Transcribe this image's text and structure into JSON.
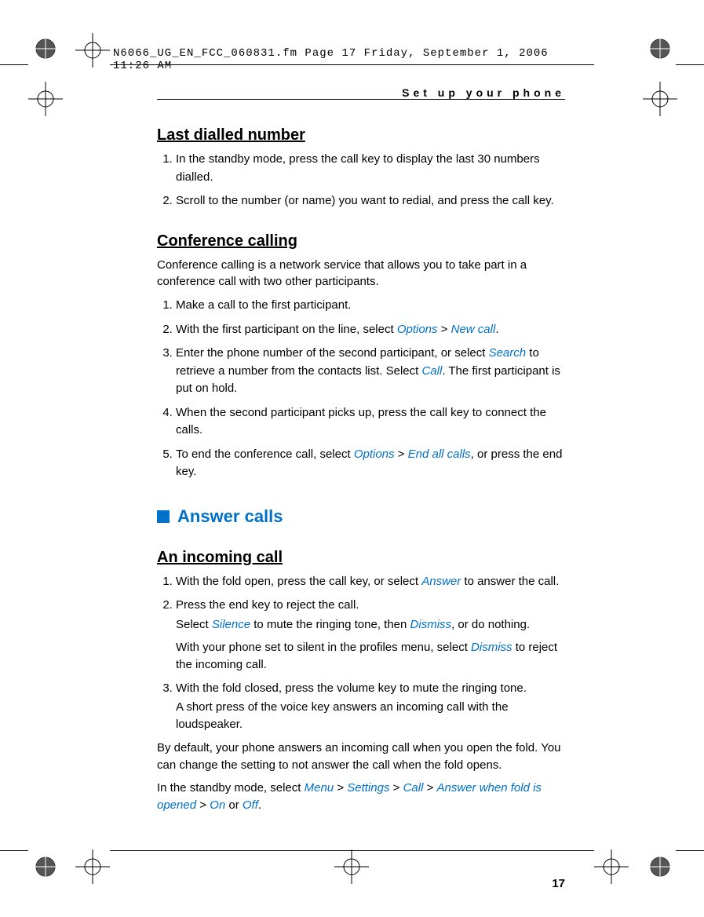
{
  "header_line": "N6066_UG_EN_FCC_060831.fm  Page 17  Friday, September 1, 2006  11:26 AM",
  "running_head": "Set up your phone",
  "page_number": "17",
  "sections": {
    "last_dialled": {
      "title": "Last dialled number",
      "steps": [
        "In the standby mode, press the call key to display the last 30 numbers dialled.",
        "Scroll to the number (or name) you want to redial, and press the call key."
      ]
    },
    "conference": {
      "title": "Conference calling",
      "intro": "Conference calling is a network service that allows you to take part in a conference call with two other participants.",
      "step1": "Make a call to the first participant.",
      "step2_before": "With the first participant on the line, select ",
      "step2_opt": "Options",
      "step2_sep": " > ",
      "step2_newcall": "New call",
      "step2_after": ".",
      "step3_before": "Enter the phone number of the second participant, or select ",
      "step3_search": "Search",
      "step3_mid": " to retrieve a number from the contacts list. Select ",
      "step3_call": "Call",
      "step3_after": ". The first participant is put on hold.",
      "step4": "When the second participant picks up, press the call key to connect the calls.",
      "step5_before": "To end the conference call, select ",
      "step5_opt": "Options",
      "step5_sep": " > ",
      "step5_end": "End all calls",
      "step5_after": ", or press the end key."
    },
    "answer_calls_heading": "Answer calls",
    "incoming": {
      "title": "An incoming call",
      "step1_before": "With the fold open, press the call key, or select ",
      "step1_answer": "Answer",
      "step1_after": " to answer the call.",
      "step2": "Press the end key to reject the call.",
      "step2b_before": "Select ",
      "step2b_silence": "Silence",
      "step2b_mid": " to mute the ringing tone, then ",
      "step2b_dismiss": "Dismiss",
      "step2b_after": ", or do nothing.",
      "step2c_before": "With your phone set to silent in the profiles menu, select ",
      "step2c_dismiss": "Dismiss",
      "step2c_after": " to reject the incoming call.",
      "step3": "With the fold closed, press the volume key to mute the ringing tone.",
      "step3b": "A short press of the voice key answers an incoming call with the loudspeaker.",
      "para1": "By default, your phone answers an incoming call when you open the fold. You can change the setting to not answer the call when the fold opens.",
      "para2_before": "In the standby mode, select ",
      "para2_menu": "Menu",
      "para2_s1": " > ",
      "para2_settings": "Settings",
      "para2_s2": " > ",
      "para2_call": "Call",
      "para2_s3": " > ",
      "para2_awfo": "Answer when fold is opened",
      "para2_s4": " > ",
      "para2_on": "On",
      "para2_or": " or ",
      "para2_off": "Off",
      "para2_after": "."
    }
  }
}
